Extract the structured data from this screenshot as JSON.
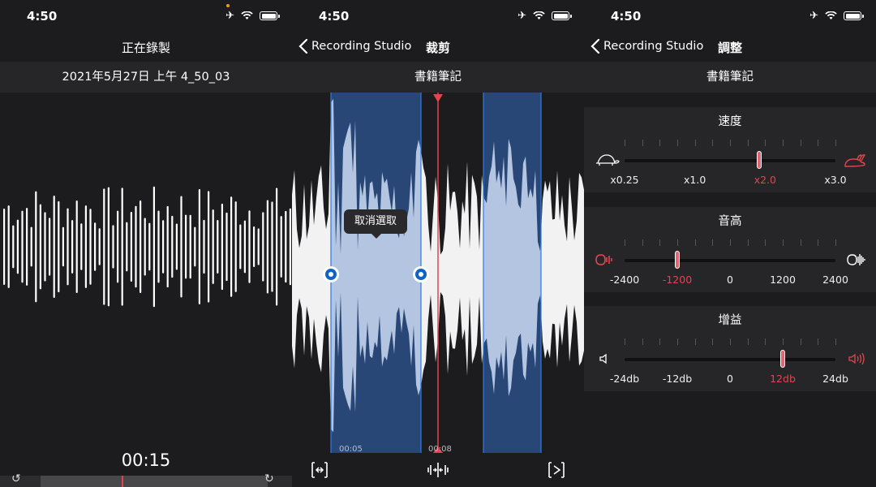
{
  "status_bar": {
    "time": "4:50"
  },
  "screen1": {
    "title": "正在錄製",
    "recording_name": "2021年5月27日 上午 4_50_03",
    "timer": "00:15"
  },
  "screen2": {
    "back_label": "Recording Studio",
    "title": "裁剪",
    "recording_name": "書籍筆記",
    "tooltip": "取消選取",
    "time_markers": [
      "00:05",
      "00:08"
    ],
    "tools": [
      "trim-icon",
      "split-icon",
      "trim-end-icon"
    ]
  },
  "screen3": {
    "back_label": "Recording Studio",
    "title": "調整",
    "recording_name": "書籍筆記",
    "panels": [
      {
        "title": "速度",
        "labels": [
          "x0.25",
          "x1.0",
          "x2.0",
          "x3.0"
        ],
        "selected": "x2.0",
        "value_fraction": 0.64,
        "left_icon": "turtle-icon",
        "right_icon": "rabbit-icon"
      },
      {
        "title": "音高",
        "labels": [
          "-2400",
          "-1200",
          "0",
          "1200",
          "2400"
        ],
        "selected": "-1200",
        "value_fraction": 0.25,
        "left_icon": "low-pitch-icon",
        "right_icon": "high-pitch-icon"
      },
      {
        "title": "增益",
        "labels": [
          "-24db",
          "-12db",
          "0",
          "12db",
          "24db"
        ],
        "selected": "12db",
        "value_fraction": 0.75,
        "left_icon": "speaker-low-icon",
        "right_icon": "speaker-high-icon"
      }
    ]
  },
  "colors": {
    "background": "#1c1c1e",
    "bar": "#262628",
    "accent_red": "#e0454f",
    "selection_blue": "#1e4f96",
    "handle_blue": "#1062c4"
  }
}
